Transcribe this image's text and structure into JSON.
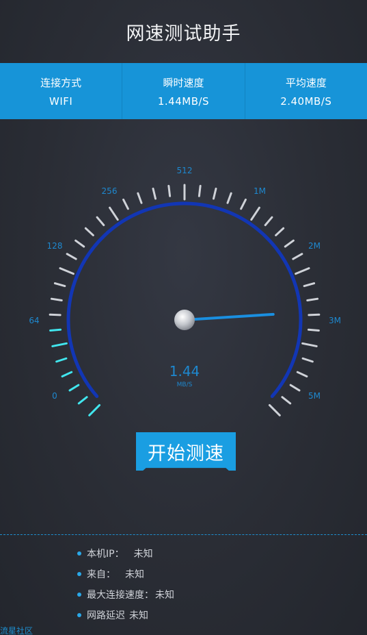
{
  "app": {
    "title": "网速测试助手"
  },
  "stats": [
    {
      "label": "连接方式",
      "value": "WIFI"
    },
    {
      "label": "瞬时速度",
      "value": "1.44MB/S"
    },
    {
      "label": "平均速度",
      "value": "2.40MB/S"
    }
  ],
  "gauge": {
    "scale_labels": [
      "0",
      "64",
      "128",
      "256",
      "512",
      "1M",
      "2M",
      "3M",
      "5M"
    ],
    "reading": "1.44",
    "unit": "MB/S",
    "fraction": 0.82,
    "active_fraction": 0.17,
    "colors": {
      "arc": "#1236b4",
      "active_tick": "#41e6ee",
      "tick": "#cfd2d8",
      "label": "#1e88cf",
      "needle": "#1a8fe0"
    }
  },
  "actions": {
    "start_label": "开始测速"
  },
  "info": [
    {
      "key": "本机IP：",
      "value": "未知"
    },
    {
      "key": "来自：",
      "value": "未知"
    },
    {
      "key": "最大连接速度：",
      "value": "未知"
    },
    {
      "key": "网路延迟",
      "value": "未知"
    }
  ],
  "watermark": "流星社区"
}
